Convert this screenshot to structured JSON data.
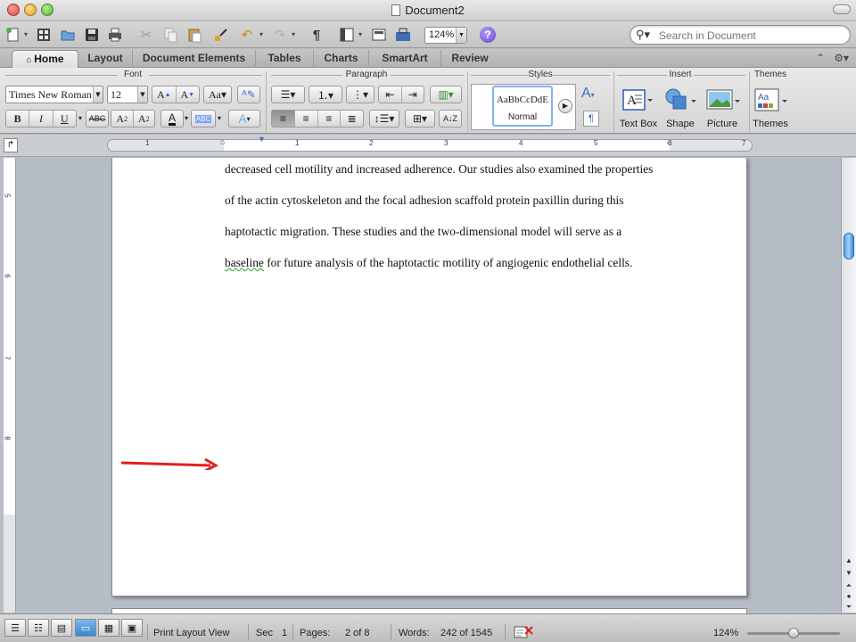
{
  "window": {
    "title": "Document2"
  },
  "toolbar": {
    "zoom_value": "124%"
  },
  "search": {
    "placeholder": "Search in Document"
  },
  "tabs": [
    {
      "label": "Home"
    },
    {
      "label": "Layout"
    },
    {
      "label": "Document Elements"
    },
    {
      "label": "Tables"
    },
    {
      "label": "Charts"
    },
    {
      "label": "SmartArt"
    },
    {
      "label": "Review"
    }
  ],
  "ribbon": {
    "groups": {
      "font": "Font",
      "paragraph": "Paragraph",
      "styles": "Styles",
      "insert": "Insert",
      "themes": "Themes"
    },
    "font_name": "Times New Roman",
    "font_size": "12",
    "style_sample": "AaBbCcDdE",
    "style_name": "Normal",
    "insert_text_box": "Text Box",
    "insert_shape": "Shape",
    "insert_picture": "Picture",
    "themes_label": "Themes"
  },
  "ruler": {
    "numbers": [
      "1",
      "1",
      "2",
      "3",
      "4",
      "5",
      "6",
      "7"
    ]
  },
  "vruler": {
    "numbers": [
      "5",
      "6",
      "7",
      "8"
    ]
  },
  "document": {
    "lines": [
      "decreased cell motility and increased adherence. Our studies also examined the properties",
      "of the actin cytoskeleton and the focal adhesion scaffold protein paxillin during this",
      "haptotactic migration. These studies and the two-dimensional model will serve as a"
    ],
    "last_line_flagged": "baseline",
    "last_line_rest": " for future analysis of the haptotactic motility of angiogenic endothelial cells."
  },
  "status": {
    "view": "Print Layout View",
    "sec_label": "Sec",
    "sec_value": "1",
    "pages_label": "Pages:",
    "pages_value": "2 of 8",
    "words_label": "Words:",
    "words_value": "242 of 1545",
    "zoom": "124%"
  },
  "colors": {
    "annotation_arrow": "#e02020",
    "scroll_thumb": "#5fa4e8",
    "spelling_squiggle": "#2da02d"
  }
}
